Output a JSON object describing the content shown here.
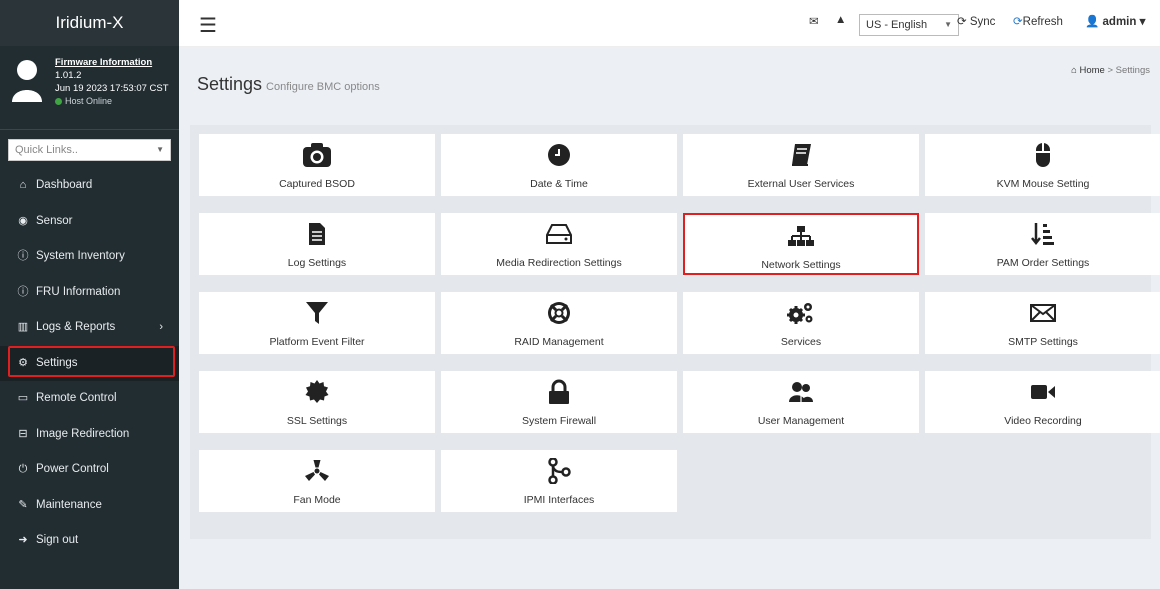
{
  "brand": "Iridium-X",
  "firmware": {
    "title": "Firmware Information",
    "version": "1.01.2",
    "date": "Jun 19 2023 17:53:07 CST",
    "host_status": "Host Online"
  },
  "quick_links": {
    "placeholder": "Quick Links.."
  },
  "nav": [
    {
      "label": "Dashboard",
      "icon": "dashboard-icon"
    },
    {
      "label": "Sensor",
      "icon": "sensor-icon"
    },
    {
      "label": "System Inventory",
      "icon": "info-icon"
    },
    {
      "label": "FRU Information",
      "icon": "info-icon"
    },
    {
      "label": "Logs & Reports",
      "icon": "bar-chart-icon"
    },
    {
      "label": "Settings",
      "icon": "gear-icon"
    },
    {
      "label": "Remote Control",
      "icon": "monitor-icon"
    },
    {
      "label": "Image Redirection",
      "icon": "drive-icon"
    },
    {
      "label": "Power Control",
      "icon": "power-icon"
    },
    {
      "label": "Maintenance",
      "icon": "wrench-icon"
    },
    {
      "label": "Sign out",
      "icon": "sign-out-icon"
    }
  ],
  "topbar": {
    "language": "US - English",
    "sync": "Sync",
    "refresh": "Refresh",
    "user": "admin"
  },
  "page": {
    "title": "Settings",
    "subtitle": "Configure BMC options",
    "breadcrumb_home": "Home",
    "breadcrumb_current": "Settings"
  },
  "tiles": [
    {
      "label": "Captured BSOD",
      "icon": "camera-icon"
    },
    {
      "label": "Date & Time",
      "icon": "clock-icon"
    },
    {
      "label": "External User Services",
      "icon": "book-icon"
    },
    {
      "label": "KVM Mouse Setting",
      "icon": "mouse-icon"
    },
    {
      "label": "Log Settings",
      "icon": "file-icon"
    },
    {
      "label": "Media Redirection Settings",
      "icon": "hdd-icon"
    },
    {
      "label": "Network Settings",
      "icon": "sitemap-icon"
    },
    {
      "label": "PAM Order Settings",
      "icon": "sort-icon"
    },
    {
      "label": "Platform Event Filter",
      "icon": "filter-icon"
    },
    {
      "label": "RAID Management",
      "icon": "lifebuoy-icon"
    },
    {
      "label": "Services",
      "icon": "cogs-icon"
    },
    {
      "label": "SMTP Settings",
      "icon": "envelope-icon"
    },
    {
      "label": "SSL Settings",
      "icon": "certificate-icon"
    },
    {
      "label": "System Firewall",
      "icon": "lock-icon"
    },
    {
      "label": "User Management",
      "icon": "users-icon"
    },
    {
      "label": "Video Recording",
      "icon": "video-icon"
    },
    {
      "label": "Fan Mode",
      "icon": "fan-icon"
    },
    {
      "label": "IPMI Interfaces",
      "icon": "connection-icon"
    }
  ],
  "colors": {
    "sidebar": "#222d32",
    "highlight": "#e02020",
    "refresh": "#2a7ac7"
  }
}
